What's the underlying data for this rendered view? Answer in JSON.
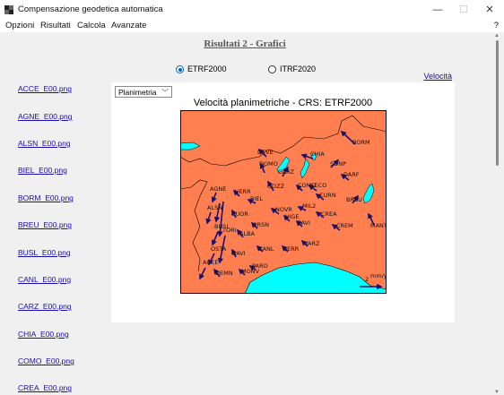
{
  "window": {
    "title": "Compensazione geodetica automatica",
    "minimize": "—",
    "maximize": "☐",
    "close": "✕"
  },
  "menu": {
    "items": [
      "Opzioni",
      "Risultati",
      "Calcola",
      "Avanzate"
    ],
    "help": "?"
  },
  "page": {
    "heading": "Risultati 2 - Grafici"
  },
  "reference_frame": {
    "options": [
      {
        "label": "ETRF2000",
        "selected": true
      },
      {
        "label": "ITRF2020",
        "selected": false
      }
    ]
  },
  "velocity_link": "Velocità",
  "files": [
    "ACCE_E00.png",
    "AGNE_E00.png",
    "ALSN_E00.png",
    "BIEL_E00.png",
    "BORM_E00.png",
    "BREU_E00.png",
    "BUSL_E00.png",
    "CANL_E00.png",
    "CARZ_E00.png",
    "CHIA_E00.png",
    "COMO_E00.png",
    "CREA_E00.png"
  ],
  "plot": {
    "select_value": "Planimetria",
    "title": "Velocità planimetriche - CRS: ETRF2000",
    "scale_label": "2",
    "scale_unit": "mm/yr",
    "colors": {
      "land": "#ff7f50",
      "water": "#00ffff",
      "vector": "#1a1070",
      "border": "#000000"
    },
    "stations": [
      "BORM",
      "DEVE",
      "CHIA",
      "SONP",
      "DOMO",
      "CARZ",
      "DARF",
      "GOZZ",
      "COMO",
      "LECO",
      "CURN",
      "BREU",
      "AGNE",
      "VERR",
      "BIEL",
      "NOVR",
      "MIL2",
      "CREA",
      "MANT",
      "ALSN",
      "CUOR",
      "PAVI",
      "VIGE",
      "CREM",
      "BUSL",
      "CRSN",
      "TORI",
      "ALBA",
      "VARZ",
      "CANL",
      "SERR",
      "OSTA",
      "SAVI",
      "ACCE",
      "PARO",
      "DEMN",
      "MONV"
    ]
  }
}
